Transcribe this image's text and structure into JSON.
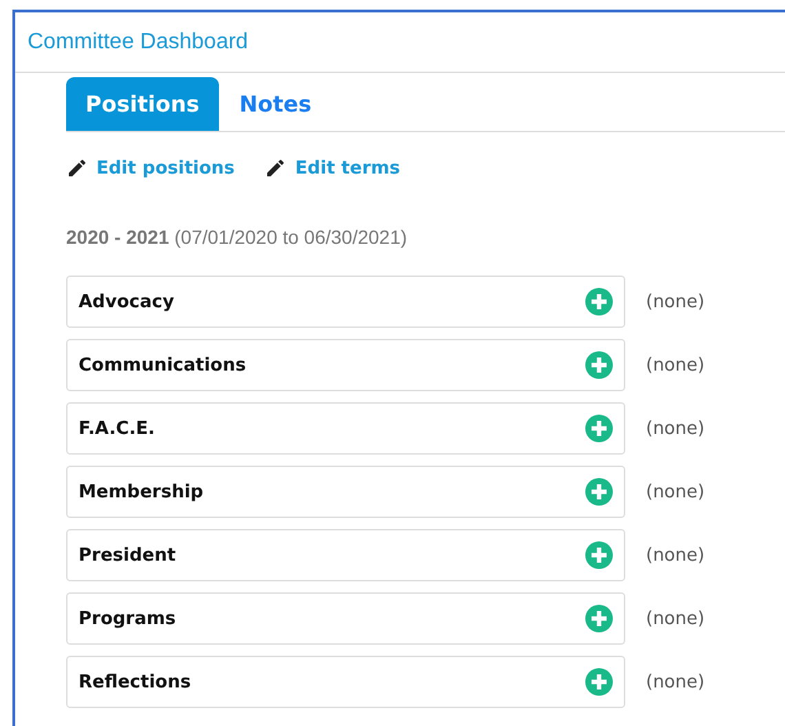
{
  "panel": {
    "title": "Committee Dashboard"
  },
  "tabs": [
    {
      "label": "Positions",
      "selected": true
    },
    {
      "label": "Notes",
      "selected": false
    }
  ],
  "actions": [
    "Edit positions",
    "Edit terms"
  ],
  "term": {
    "years": "2020 - 2021",
    "dates": "(07/01/2020 to 06/30/2021)"
  },
  "positions": [
    {
      "name": "Advocacy",
      "holder": "(none)"
    },
    {
      "name": "Communications",
      "holder": "(none)"
    },
    {
      "name": "F.A.C.E.",
      "holder": "(none)"
    },
    {
      "name": "Membership",
      "holder": "(none)"
    },
    {
      "name": "President",
      "holder": "(none)"
    },
    {
      "name": "Programs",
      "holder": "(none)"
    },
    {
      "name": "Reflections",
      "holder": "(none)"
    }
  ]
}
